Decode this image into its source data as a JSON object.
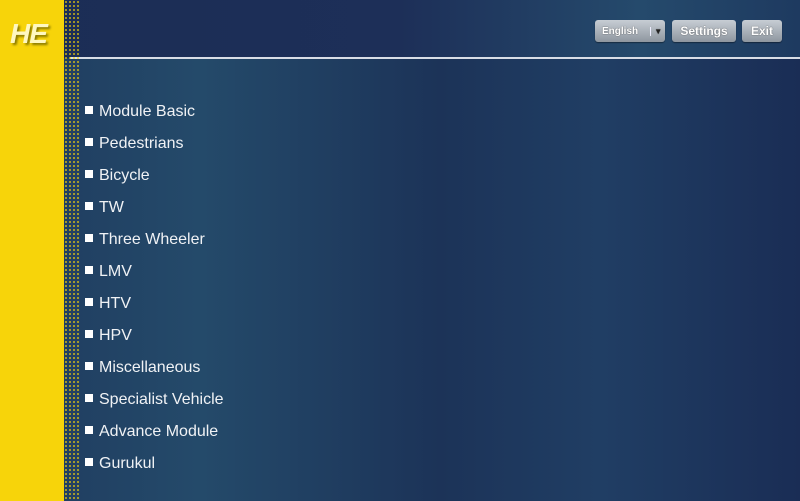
{
  "logo": {
    "text": "HE"
  },
  "header": {
    "language": {
      "selected": "English"
    },
    "settings_label": "Settings",
    "exit_label": "Exit"
  },
  "menu": {
    "items": [
      {
        "label": "Module Basic"
      },
      {
        "label": "Pedestrians"
      },
      {
        "label": "Bicycle"
      },
      {
        "label": "TW"
      },
      {
        "label": "Three Wheeler"
      },
      {
        "label": "LMV"
      },
      {
        "label": "HTV"
      },
      {
        "label": "HPV"
      },
      {
        "label": "Miscellaneous"
      },
      {
        "label": "Specialist Vehicle"
      },
      {
        "label": "Advance Module"
      },
      {
        "label": "Gurukul"
      }
    ]
  }
}
